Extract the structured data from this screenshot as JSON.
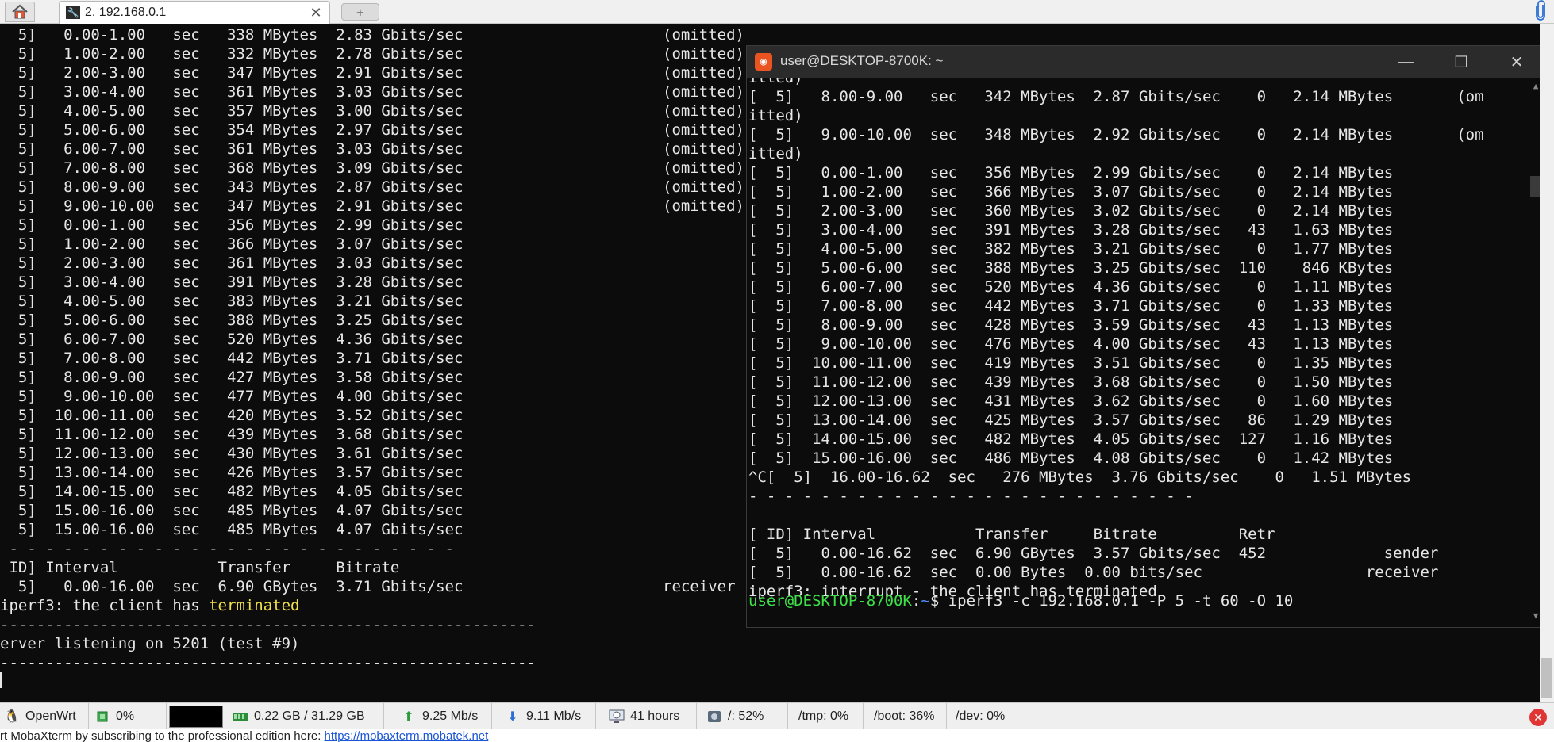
{
  "tabbar": {
    "home_icon": "home-icon",
    "tab_label": "2. 192.168.0.1",
    "tab_close": "✕",
    "new_tab_glyph": "+"
  },
  "main_terminal": {
    "lines": [
      "  5]   0.00-1.00   sec   338 MBytes  2.83 Gbits/sec                      (omitted)",
      "  5]   1.00-2.00   sec   332 MBytes  2.78 Gbits/sec                      (omitted)",
      "  5]   2.00-3.00   sec   347 MBytes  2.91 Gbits/sec                      (omitted)",
      "  5]   3.00-4.00   sec   361 MBytes  3.03 Gbits/sec                      (omitted)",
      "  5]   4.00-5.00   sec   357 MBytes  3.00 Gbits/sec                      (omitted)",
      "  5]   5.00-6.00   sec   354 MBytes  2.97 Gbits/sec                      (omitted)",
      "  5]   6.00-7.00   sec   361 MBytes  3.03 Gbits/sec                      (omitted)",
      "  5]   7.00-8.00   sec   368 MBytes  3.09 Gbits/sec                      (omitted)",
      "  5]   8.00-9.00   sec   343 MBytes  2.87 Gbits/sec                      (omitted)",
      "  5]   9.00-10.00  sec   347 MBytes  2.91 Gbits/sec                      (omitted)",
      "  5]   0.00-1.00   sec   356 MBytes  2.99 Gbits/sec",
      "  5]   1.00-2.00   sec   366 MBytes  3.07 Gbits/sec",
      "  5]   2.00-3.00   sec   361 MBytes  3.03 Gbits/sec",
      "  5]   3.00-4.00   sec   391 MBytes  3.28 Gbits/sec",
      "  5]   4.00-5.00   sec   383 MBytes  3.21 Gbits/sec",
      "  5]   5.00-6.00   sec   388 MBytes  3.25 Gbits/sec",
      "  5]   6.00-7.00   sec   520 MBytes  4.36 Gbits/sec",
      "  5]   7.00-8.00   sec   442 MBytes  3.71 Gbits/sec",
      "  5]   8.00-9.00   sec   427 MBytes  3.58 Gbits/sec",
      "  5]   9.00-10.00  sec   477 MBytes  4.00 Gbits/sec",
      "  5]  10.00-11.00  sec   420 MBytes  3.52 Gbits/sec",
      "  5]  11.00-12.00  sec   439 MBytes  3.68 Gbits/sec",
      "  5]  12.00-13.00  sec   430 MBytes  3.61 Gbits/sec",
      "  5]  13.00-14.00  sec   426 MBytes  3.57 Gbits/sec",
      "  5]  14.00-15.00  sec   482 MBytes  4.05 Gbits/sec",
      "  5]  15.00-16.00  sec   485 MBytes  4.07 Gbits/sec",
      "  5]  15.00-16.00  sec   485 MBytes  4.07 Gbits/sec",
      " - - - - - - - - - - - - - - - - - - - - - - - - -",
      " ID] Interval           Transfer     Bitrate",
      "  5]   0.00-16.00  sec  6.90 GBytes  3.71 Gbits/sec                      receiver"
    ],
    "terminated_prefix": "iperf3: the client has ",
    "terminated_word": "terminated",
    "separator1": "-----------------------------------------------------------",
    "listening": "erver listening on 5201 (test #9)",
    "separator2": "-----------------------------------------------------------"
  },
  "inner_window": {
    "title": "user@DESKTOP-8700K: ~",
    "app_icon": "ubuntu-icon",
    "controls": {
      "minimize": "—",
      "maximize": "☐",
      "close": "✕"
    },
    "lines": [
      "itted)",
      "[  5]   8.00-9.00   sec   342 MBytes  2.87 Gbits/sec    0   2.14 MBytes       (om",
      "itted)",
      "[  5]   9.00-10.00  sec   348 MBytes  2.92 Gbits/sec    0   2.14 MBytes       (om",
      "itted)",
      "[  5]   0.00-1.00   sec   356 MBytes  2.99 Gbits/sec    0   2.14 MBytes",
      "[  5]   1.00-2.00   sec   366 MBytes  3.07 Gbits/sec    0   2.14 MBytes",
      "[  5]   2.00-3.00   sec   360 MBytes  3.02 Gbits/sec    0   2.14 MBytes",
      "[  5]   3.00-4.00   sec   391 MBytes  3.28 Gbits/sec   43   1.63 MBytes",
      "[  5]   4.00-5.00   sec   382 MBytes  3.21 Gbits/sec    0   1.77 MBytes",
      "[  5]   5.00-6.00   sec   388 MBytes  3.25 Gbits/sec  110    846 KBytes",
      "[  5]   6.00-7.00   sec   520 MBytes  4.36 Gbits/sec    0   1.11 MBytes",
      "[  5]   7.00-8.00   sec   442 MBytes  3.71 Gbits/sec    0   1.33 MBytes",
      "[  5]   8.00-9.00   sec   428 MBytes  3.59 Gbits/sec   43   1.13 MBytes",
      "[  5]   9.00-10.00  sec   476 MBytes  4.00 Gbits/sec   43   1.13 MBytes",
      "[  5]  10.00-11.00  sec   419 MBytes  3.51 Gbits/sec    0   1.35 MBytes",
      "[  5]  11.00-12.00  sec   439 MBytes  3.68 Gbits/sec    0   1.50 MBytes",
      "[  5]  12.00-13.00  sec   431 MBytes  3.62 Gbits/sec    0   1.60 MBytes",
      "[  5]  13.00-14.00  sec   425 MBytes  3.57 Gbits/sec   86   1.29 MBytes",
      "[  5]  14.00-15.00  sec   482 MBytes  4.05 Gbits/sec  127   1.16 MBytes",
      "[  5]  15.00-16.00  sec   486 MBytes  4.08 Gbits/sec    0   1.42 MBytes",
      "^C[  5]  16.00-16.62  sec   276 MBytes  3.76 Gbits/sec    0   1.51 MBytes",
      "- - - - - - - - - - - - - - - - - - - - - - - - -",
      "",
      "[ ID] Interval           Transfer     Bitrate         Retr",
      "[  5]   0.00-16.62  sec  6.90 GBytes  3.57 Gbits/sec  452             sender",
      "[  5]   0.00-16.62  sec  0.00 Bytes  0.00 bits/sec                  receiver",
      "iperf3: interrupt - the client has terminated"
    ],
    "prompt_user": "user@DESKTOP-8700K",
    "prompt_sep": ":",
    "prompt_path": "~",
    "prompt_cmd": "$ iperf3 -c 192.168.0.1 -P 5 -t 60 -O 10"
  },
  "statusbar": {
    "host": "OpenWrt",
    "cpu": "0%",
    "memory": "0.22 GB / 31.29 GB",
    "upload": "9.25 Mb/s",
    "download": "9.11 Mb/s",
    "uptime": "41 hours",
    "root_usage": "/: 52%",
    "tmp_usage": "/tmp: 0%",
    "boot_usage": "/boot: 36%",
    "dev_usage": "/dev: 0%"
  },
  "banner": {
    "text": "rt MobaXterm by subscribing to the professional edition here:  ",
    "link": "https://mobaxterm.mobatek.net"
  },
  "colors": {
    "terminal_bg": "#0c0c0c",
    "terminal_fg": "#e6e6e6",
    "highlight_yellow": "#f2e24a",
    "prompt_green": "#3ee049",
    "prompt_blue": "#4f8cff"
  }
}
